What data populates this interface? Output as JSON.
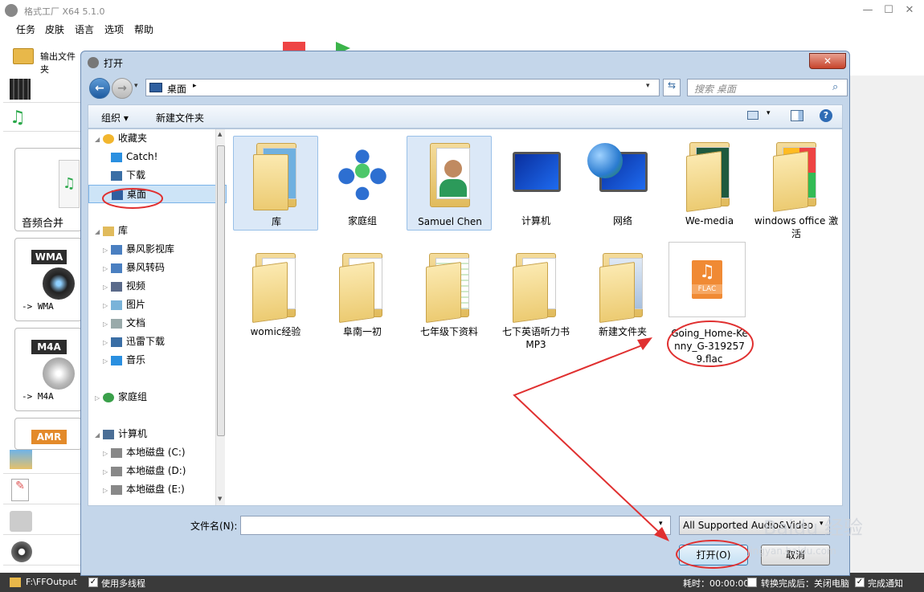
{
  "app": {
    "title": "格式工厂 X64 5.1.0",
    "menu": [
      "任务",
      "皮肤",
      "语言",
      "选项",
      "帮助"
    ],
    "output_btn": "输出文件夹",
    "nav_cards": [
      {
        "badge": "",
        "label": "音频合并"
      },
      {
        "badge": "WMA",
        "label": "-> WMA"
      },
      {
        "badge": "M4A",
        "label": "-> M4A"
      },
      {
        "badge": "AMR",
        "label": ""
      }
    ],
    "status": {
      "output_path": "F:\\FFOutput",
      "multithread": "使用多线程",
      "elapsed": "耗时：00:00:00",
      "after_convert": "转换完成后：关闭电脑",
      "notify": "完成通知"
    }
  },
  "dialog": {
    "title": "打开",
    "address": "桌面",
    "search_placeholder": "搜索 桌面",
    "organize": "组织 ▾",
    "new_folder": "新建文件夹",
    "tree": [
      {
        "label": "收藏夹",
        "level": 0,
        "icon": "star-icon",
        "expand": "open"
      },
      {
        "label": "Catch!",
        "level": 1,
        "icon": "lightning-icon",
        "expand": ""
      },
      {
        "label": "下载",
        "level": 1,
        "icon": "download-icon",
        "expand": ""
      },
      {
        "label": "桌面",
        "level": 1,
        "icon": "desktop-icon",
        "expand": "",
        "selected": true
      },
      {
        "label": "",
        "level": 0,
        "icon": "",
        "expand": ""
      },
      {
        "label": "库",
        "level": 0,
        "icon": "library-icon",
        "expand": "open"
      },
      {
        "label": "暴风影视库",
        "level": 1,
        "icon": "video-lib-icon",
        "expand": "closed"
      },
      {
        "label": "暴风转码",
        "level": 1,
        "icon": "video-lib-icon",
        "expand": "closed"
      },
      {
        "label": "视频",
        "level": 1,
        "icon": "video-icon",
        "expand": "closed"
      },
      {
        "label": "图片",
        "level": 1,
        "icon": "picture-icon",
        "expand": "closed"
      },
      {
        "label": "文档",
        "level": 1,
        "icon": "document-icon",
        "expand": "closed"
      },
      {
        "label": "迅雷下载",
        "level": 1,
        "icon": "download-icon",
        "expand": "closed"
      },
      {
        "label": "音乐",
        "level": 1,
        "icon": "music-icon",
        "expand": "closed"
      },
      {
        "label": "",
        "level": 0,
        "icon": "",
        "expand": ""
      },
      {
        "label": "家庭组",
        "level": 0,
        "icon": "homegroup-icon",
        "expand": "closed"
      },
      {
        "label": "",
        "level": 0,
        "icon": "",
        "expand": ""
      },
      {
        "label": "计算机",
        "level": 0,
        "icon": "computer-icon",
        "expand": "open"
      },
      {
        "label": "本地磁盘 (C:)",
        "level": 1,
        "icon": "drive-icon",
        "expand": "closed"
      },
      {
        "label": "本地磁盘 (D:)",
        "level": 1,
        "icon": "drive-icon",
        "expand": "closed"
      },
      {
        "label": "本地磁盘 (E:)",
        "level": 1,
        "icon": "drive-icon",
        "expand": "closed"
      }
    ],
    "items": [
      {
        "label": "库",
        "type": "library",
        "selected": true
      },
      {
        "label": "家庭组",
        "type": "homegroup"
      },
      {
        "label": "Samuel Chen",
        "type": "user",
        "selected": true
      },
      {
        "label": "计算机",
        "type": "computer"
      },
      {
        "label": "网络",
        "type": "network"
      },
      {
        "label": "We-media",
        "type": "folder-green"
      },
      {
        "label": "windows office 激活",
        "type": "folder-office"
      },
      {
        "label": "womic经验",
        "type": "folder"
      },
      {
        "label": "阜南一初",
        "type": "folder-docs"
      },
      {
        "label": "七年级下资料",
        "type": "folder-sheets"
      },
      {
        "label": "七下英语听力书MP3",
        "type": "folder-white"
      },
      {
        "label": "新建文件夹",
        "type": "folder-screens"
      },
      {
        "label": "Going_Home-Kenny_G-3192579.flac",
        "type": "flac",
        "selected": true
      }
    ],
    "filename_label": "文件名(N):",
    "filename_value": "",
    "filetype": "All Supported Audio&Video",
    "open_btn": "打开(O)",
    "cancel_btn": "取消",
    "accent": "#e03030"
  },
  "watermark": "Baidu 经验",
  "watermark_url": "jingyan.baidu.com"
}
